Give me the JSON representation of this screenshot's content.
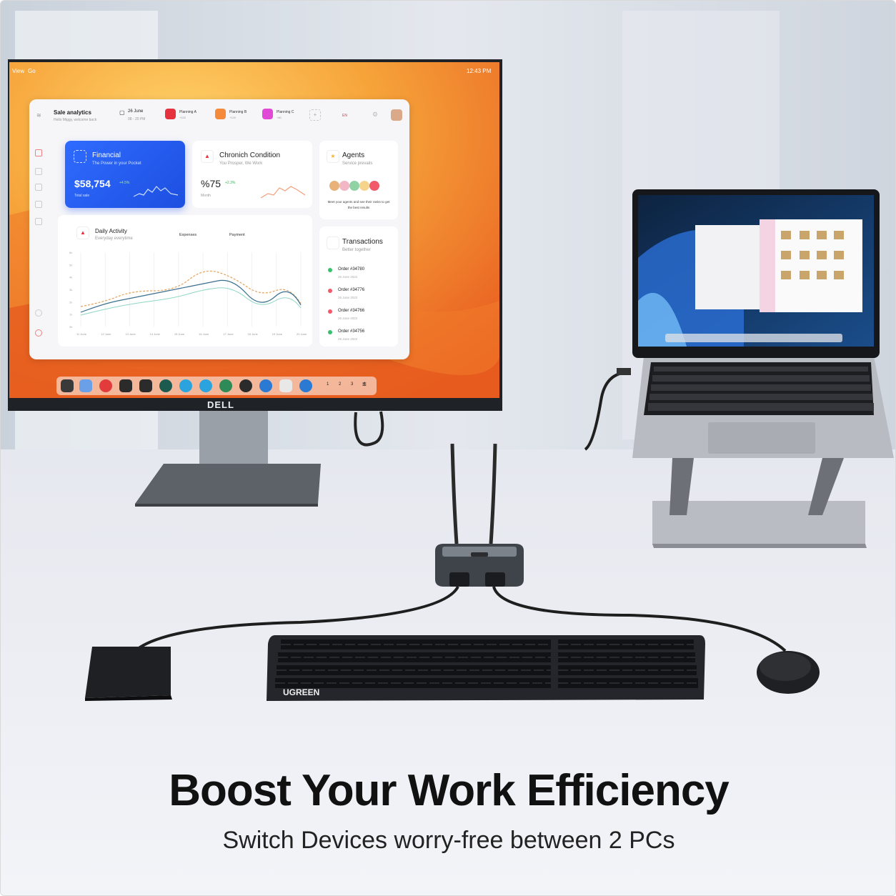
{
  "headline": "Boost Your Work Efficiency",
  "subheadline": "Switch Devices worry-free between 2 PCs",
  "monitor_brand": "DELL",
  "keyboard_brand": "UGREEN",
  "screen": {
    "menubar": {
      "items": [
        "View",
        "Go"
      ],
      "clock": "12:43 PM"
    },
    "header": {
      "title": "Sale analytics",
      "subtitle": "Hello Miggy, welcome back",
      "date": "26 June",
      "time": "08 - 20 PM",
      "planning": [
        {
          "label": "Planning A",
          "sub": "+120",
          "color": "#e6313f"
        },
        {
          "label": "Planning B",
          "sub": "+120",
          "color": "#f58a3a"
        },
        {
          "label": "Planning C",
          "sub": "+80",
          "color": "#e04ad6"
        }
      ],
      "lang": "EN"
    },
    "financial": {
      "title": "Financial",
      "subtitle": "The Power in your Pocket",
      "value": "$58,754",
      "change": "+4.5%",
      "label": "Total sale"
    },
    "chronic": {
      "title": "Chronich Condition",
      "subtitle": "You Prosper, We Work",
      "value": "%75",
      "change": "+2.3%",
      "label": "Month"
    },
    "agents": {
      "title": "Agents",
      "subtitle": "Service prevails",
      "description": "Meet your agents and see their ranks to get the best results"
    },
    "activity": {
      "title": "Daily Activity",
      "subtitle": "Everyday everytime",
      "legend": [
        "Expenses",
        "Payment"
      ],
      "y_ticks": [
        "0k",
        "1k",
        "2k",
        "3k",
        "4k",
        "5k",
        "6k"
      ],
      "x_ticks": [
        "11 June",
        "12 June",
        "13 June",
        "14 June",
        "15 June",
        "16 June",
        "17 June",
        "18 June",
        "19 June",
        "20 June"
      ]
    },
    "transactions": {
      "title": "Transactions",
      "subtitle": "Better together",
      "orders": [
        {
          "id": "Order #34780",
          "date": "26 June 2022",
          "status": "#37c26a"
        },
        {
          "id": "Order #34776",
          "date": "26 June 2022",
          "status": "#f05a6b"
        },
        {
          "id": "Order #34766",
          "date": "26 June 2022",
          "status": "#f05a6b"
        },
        {
          "id": "Order #34756",
          "date": "26 June 2022",
          "status": "#37c26a"
        }
      ]
    },
    "dock_pages": "1 2 3 4"
  },
  "colors": {
    "accent": "#2f6bff",
    "wallpaper_orange": "#f59a2a",
    "desk": "#eef0f5"
  }
}
